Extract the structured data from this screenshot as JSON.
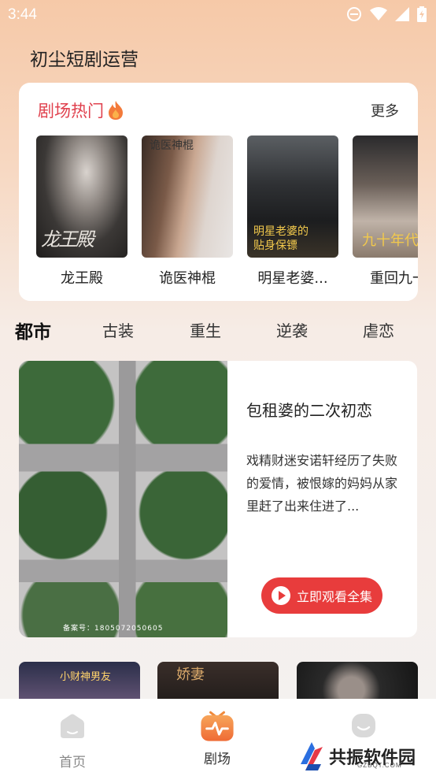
{
  "status_bar": {
    "time": "3:44"
  },
  "app": {
    "title": "初尘短剧运营"
  },
  "hot": {
    "title": "剧场热门",
    "more": "更多",
    "items": [
      {
        "name": "龙王殿"
      },
      {
        "name": "诡医神棍"
      },
      {
        "name": "明星老婆..."
      },
      {
        "name": "重回九一"
      }
    ]
  },
  "categories": [
    "都市",
    "古装",
    "重生",
    "逆袭",
    "虐恋"
  ],
  "feature": {
    "title": "包租婆的二次初恋",
    "description": "戏精财迷安诺轩经历了失败的爱情，被恨嫁的妈妈从家里赶了出来住进了...",
    "button": "立即观看全集",
    "image_caption": "备案号：1805072050605"
  },
  "nav": {
    "items": [
      {
        "label": "首页"
      },
      {
        "label": "剧场"
      },
      {
        "label": ""
      }
    ]
  },
  "watermark": {
    "text": "共振软件园",
    "sub": "GZBQT.COM"
  },
  "colors": {
    "accent": "#e0404d",
    "button": "#e83c3c",
    "nav_active": "#f08a3c"
  }
}
